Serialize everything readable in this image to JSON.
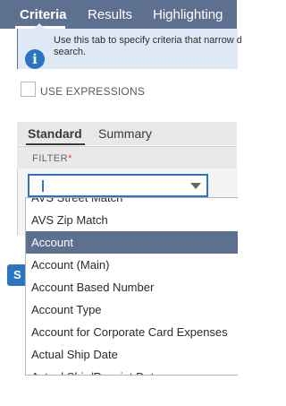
{
  "tabs": {
    "criteria": "Criteria",
    "results": "Results",
    "highlighting": "Highlighting"
  },
  "help": {
    "icon": "info-icon",
    "text": "Use this tab to specify criteria that narrow d\nsearch."
  },
  "expressions": {
    "label": "USE EXPRESSIONS",
    "checked": false
  },
  "subtabs": {
    "standard": "Standard",
    "summary": "Summary"
  },
  "filter": {
    "label": "FILTER",
    "required_mark": "*",
    "value": ""
  },
  "search_button": {
    "label": "S"
  },
  "dropdown": {
    "options": [
      "AVS Street Match",
      "AVS Zip Match",
      "Account",
      "Account (Main)",
      "Account Based Number",
      "Account Type",
      "Account for Corporate Card Expenses",
      "Actual Ship Date",
      "Actual Ship/Receipt Date"
    ],
    "selected": "Account"
  },
  "colors": {
    "tabbar": "#5e7090",
    "help_bg": "#dfe9f5",
    "accent": "#2a74c2",
    "required": "#e6532b"
  }
}
